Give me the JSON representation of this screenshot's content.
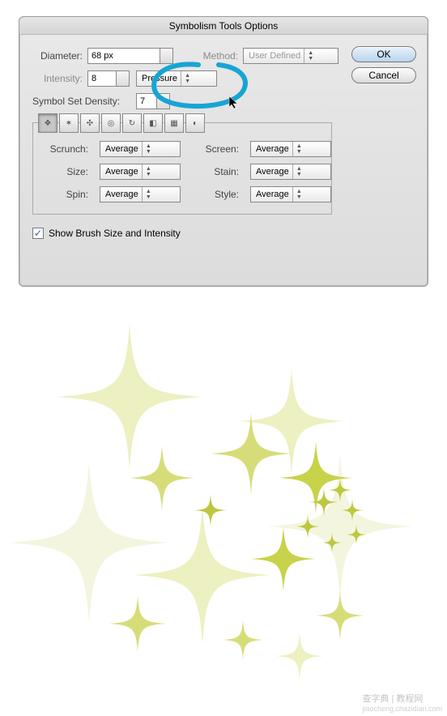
{
  "dialog": {
    "title": "Symbolism Tools Options",
    "diameter_label": "Diameter:",
    "diameter_value": "68 px",
    "method_label": "Method:",
    "method_value": "User Defined",
    "intensity_label": "Intensity:",
    "intensity_value": "8",
    "intensity_mode_value": "Pressure",
    "density_label": "Symbol Set Density:",
    "density_value": "7",
    "checkbox_label": "Show Brush Size and Intensity",
    "checkbox_checked": true,
    "ok_label": "OK",
    "cancel_label": "Cancel",
    "tools": [
      {
        "name": "sprayer-tool",
        "glyph": "❖",
        "active": true
      },
      {
        "name": "shifter-tool",
        "glyph": "✶",
        "active": false
      },
      {
        "name": "scruncher-tool",
        "glyph": "✣",
        "active": false
      },
      {
        "name": "sizer-tool",
        "glyph": "◎",
        "active": false
      },
      {
        "name": "spinner-tool",
        "glyph": "↻",
        "active": false
      },
      {
        "name": "stainer-tool",
        "glyph": "◧",
        "active": false
      },
      {
        "name": "screener-tool",
        "glyph": "▦",
        "active": false
      },
      {
        "name": "styler-tool",
        "glyph": "◐",
        "active": false
      }
    ],
    "grid": {
      "scrunch_label": "Scrunch:",
      "scrunch_value": "Average",
      "screen_label": "Screen:",
      "screen_value": "Average",
      "size_label": "Size:",
      "size_value": "Average",
      "stain_label": "Stain:",
      "stain_value": "Average",
      "spin_label": "Spin:",
      "spin_value": "Average",
      "style_label": "Style:",
      "style_value": "Average"
    }
  },
  "annotation": {
    "color": "#17a5d4",
    "target": "intensity-mode-dropdown"
  },
  "watermark": {
    "main": "查字典 | 教程网",
    "sub": "jiaocheng.chazidian.com"
  },
  "sparkle": {
    "color_main": "#d6dd78",
    "color_light": "#edf0c0",
    "color_faint": "#f4f5df"
  }
}
